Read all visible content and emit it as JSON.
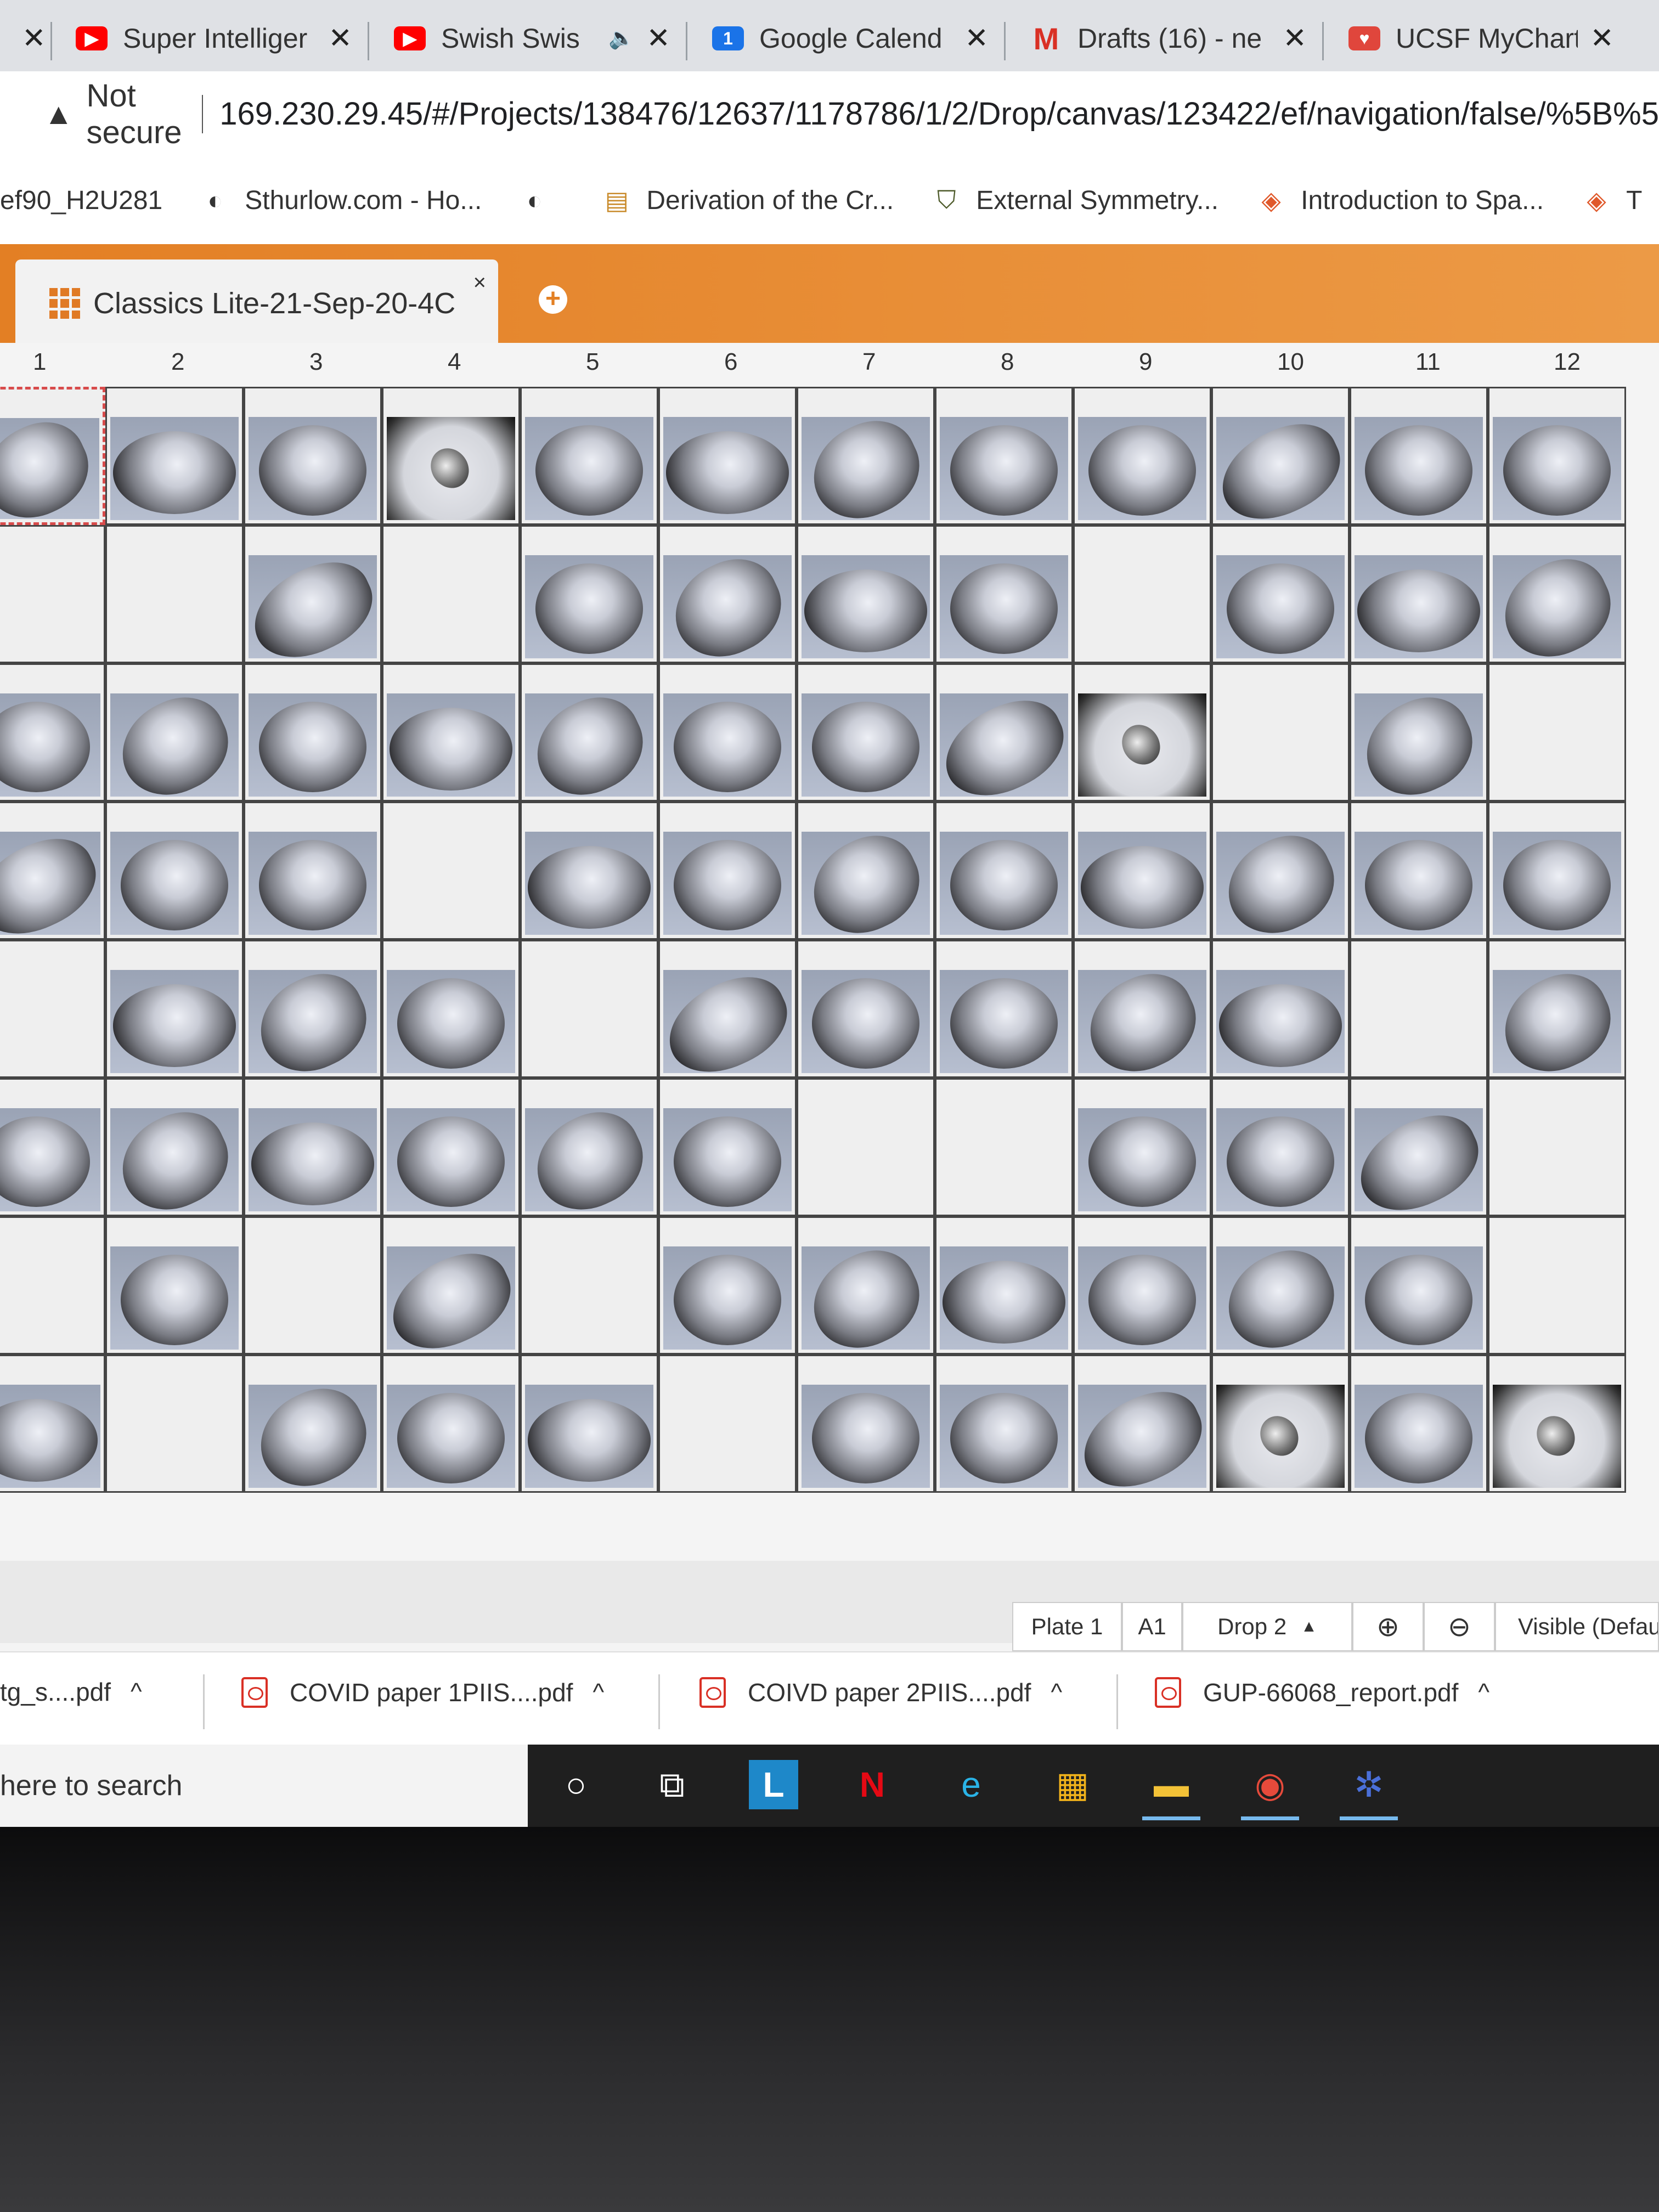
{
  "browser_tabs": [
    {
      "title": "Super Intelliger",
      "icon": "youtube-icon",
      "icon_color": "#ff0000"
    },
    {
      "title": "Swish Swis",
      "icon": "youtube-icon",
      "icon_color": "#ff0000",
      "audio": "🔈"
    },
    {
      "title": "Google Calend",
      "icon": "calendar-icon",
      "icon_color": "#1a73e8",
      "icon_text": "1"
    },
    {
      "title": "Drafts (16) - ne",
      "icon": "gmail-icon",
      "icon_color": "#d93025",
      "icon_text": "M"
    },
    {
      "title": "UCSF MyChart",
      "icon": "mychart-icon",
      "icon_color": "#e0463c"
    }
  ],
  "address_bar": {
    "security_label": "Not secure",
    "url": "169.230.29.45/#/Projects/138476/12637/1178786/1/2/Drop/canvas/123422/ef/navigation/false/%5B%5"
  },
  "bookmarks": [
    {
      "label": "ef90_H2U281",
      "icon": ""
    },
    {
      "label": "Sthurlow.com - Ho...",
      "icon": "globe-icon"
    },
    {
      "label": "",
      "icon": "globe-icon"
    },
    {
      "label": "Derivation of the Cr...",
      "icon": "book-icon"
    },
    {
      "label": "External Symmetry...",
      "icon": "shield-icon"
    },
    {
      "label": "Introduction to Spa...",
      "icon": "cube-icon"
    },
    {
      "label": "T",
      "icon": "cube-icon"
    }
  ],
  "app": {
    "tab_title": "Classics Lite-21-Sep-20-4C",
    "close_glyph": "×",
    "add_glyph": "+",
    "accent": "#e37f24"
  },
  "plate": {
    "columns": [
      "1",
      "2",
      "3",
      "4",
      "5",
      "6",
      "7",
      "8",
      "9",
      "10",
      "11",
      "12"
    ],
    "rows": [
      [
        1,
        1,
        1,
        2,
        1,
        1,
        1,
        1,
        1,
        1,
        1,
        1
      ],
      [
        0,
        0,
        1,
        0,
        1,
        1,
        1,
        1,
        0,
        1,
        1,
        1
      ],
      [
        1,
        1,
        1,
        1,
        1,
        1,
        1,
        1,
        2,
        0,
        1,
        0
      ],
      [
        1,
        1,
        1,
        0,
        1,
        1,
        1,
        1,
        1,
        1,
        1,
        1
      ],
      [
        0,
        1,
        1,
        1,
        0,
        1,
        1,
        1,
        1,
        1,
        0,
        1
      ],
      [
        1,
        1,
        1,
        1,
        1,
        1,
        0,
        0,
        1,
        1,
        1,
        0
      ],
      [
        0,
        1,
        0,
        1,
        0,
        1,
        1,
        1,
        1,
        1,
        1,
        0
      ],
      [
        1,
        0,
        1,
        1,
        1,
        0,
        1,
        1,
        1,
        2,
        1,
        2
      ]
    ],
    "selected_well": "A1"
  },
  "controls": {
    "plate": "Plate 1",
    "well": "A1",
    "drop": "Drop 2",
    "drop_caret": "▲",
    "zoom_in": "⊕",
    "zoom_out": "⊖",
    "visible": "Visible (Defau"
  },
  "downloads": [
    {
      "name": "tg_s....pdf",
      "caret": "^"
    },
    {
      "name": "COVID paper 1PIIS....pdf",
      "caret": "^"
    },
    {
      "name": "COIVD paper 2PIIS....pdf",
      "caret": "^"
    },
    {
      "name": "GUP-66068_report.pdf",
      "caret": "^"
    }
  ],
  "taskbar": {
    "search_text": "here to search",
    "icons": [
      "cortana-icon",
      "task-view-icon",
      "l-app-icon",
      "netflix-icon",
      "edge-icon",
      "store-icon",
      "file-explorer-icon",
      "chrome-icon",
      "molecule-app-icon"
    ],
    "glyphs": {
      "cortana": "○",
      "taskview": "⧉",
      "lapp": "L",
      "netflix": "N",
      "edge": "e",
      "store": "▦",
      "explorer": "▬",
      "chrome": "◉",
      "molecule": "✲"
    }
  }
}
